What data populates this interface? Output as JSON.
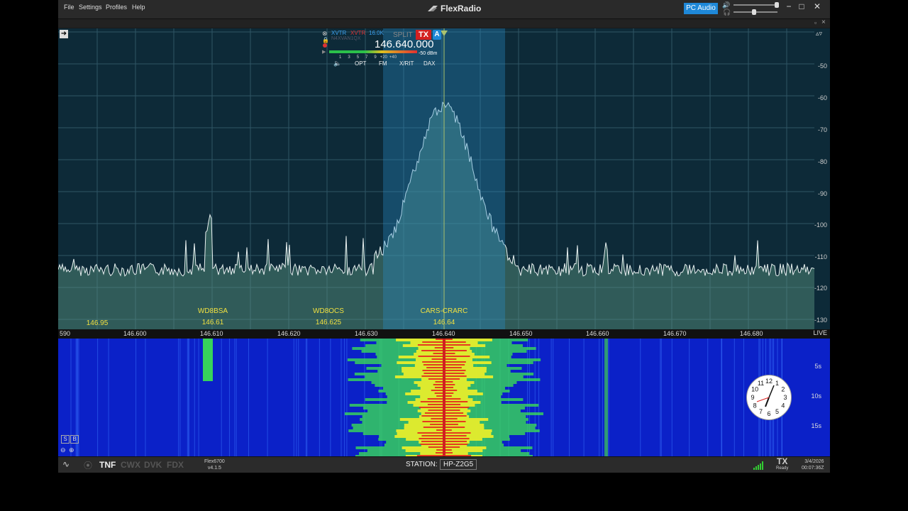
{
  "menu": [
    {
      "label": "File"
    },
    {
      "label": "Settings"
    },
    {
      "label": "Profiles"
    },
    {
      "label": "Help"
    }
  ],
  "app_title": "FlexRadio",
  "pc_audio_label": "PC Audio",
  "window_buttons": {
    "minimize": "−",
    "maximize": "□",
    "close": "✕"
  },
  "slice": {
    "xvtr1": "XVTR",
    "xvtr2": "XVTR",
    "bw": "16.0K",
    "sub": "N4XVAN1QX",
    "split": "SPLIT",
    "tx": "TX",
    "letter": "A",
    "frequency": "146.640.000",
    "meter_label": "-50 dBm",
    "meter_ticks": [
      "1",
      "3",
      "5",
      "7",
      "9",
      "+20",
      "+40"
    ],
    "buttons": [
      "OPT",
      "FM",
      "X/RIT",
      "DAX"
    ]
  },
  "dbm_scale": [
    "-50",
    "-60",
    "-70",
    "-80",
    "-90",
    "-100",
    "-110",
    "-120",
    "-130"
  ],
  "spots": [
    {
      "call": "",
      "freq": "146.95"
    },
    {
      "call": "WD8BSA",
      "freq": "146.61"
    },
    {
      "call": "WD8OCS",
      "freq": "146.625"
    },
    {
      "call": "CARS-CRARC",
      "freq": "146.64"
    }
  ],
  "freq_scale": [
    "590",
    "146.600",
    "146.610",
    "146.620",
    "146.630",
    "146.640",
    "146.650",
    "146.660",
    "146.670",
    "146.680"
  ],
  "waterfall": {
    "live": "LIVE",
    "times": [
      "5s",
      "10s",
      "15s"
    ]
  },
  "statusbar": {
    "modes": [
      "TNF",
      "CWX",
      "DVK",
      "FDX"
    ],
    "radio_model": "Flex6700",
    "radio_version": "v4.1.5",
    "station_label": "STATION:",
    "station_value": "HP-Z2G5",
    "tx": "TX",
    "tx_sub": "Ready",
    "date": "3/4/2026",
    "time": "00:07:36Z"
  },
  "colors": {
    "accent": "#1e88d8",
    "tx": "#d42020",
    "spot": "#f0e040",
    "waterfall_bg": "#0b21c8"
  },
  "clock": {
    "numbers": [
      "12",
      "1",
      "2",
      "3",
      "4",
      "5",
      "6",
      "7",
      "8",
      "9",
      "10",
      "11"
    ]
  }
}
